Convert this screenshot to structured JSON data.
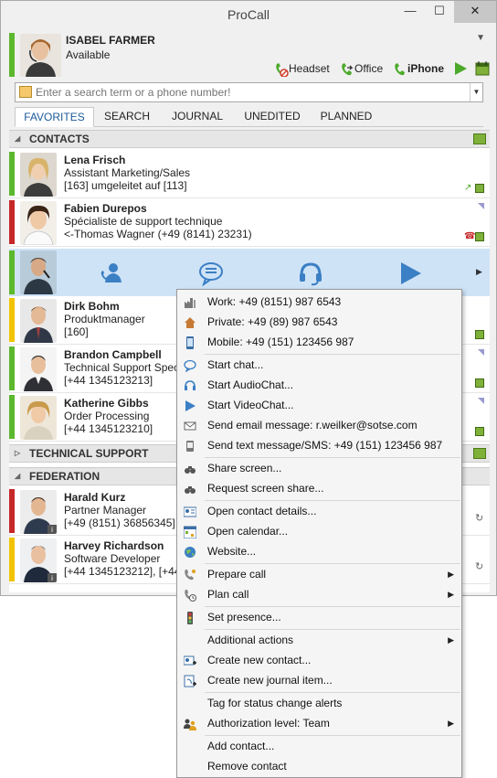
{
  "window": {
    "title": "ProCall",
    "min": "—",
    "max": "☐",
    "close": "✕"
  },
  "me": {
    "name": "ISABEL FARMER",
    "status": "Available",
    "status_color": "#5cb82e"
  },
  "devices": {
    "headset": "Headset",
    "office": "Office",
    "iphone": "iPhone"
  },
  "search": {
    "placeholder": "Enter a search term or a phone number!"
  },
  "tabs": [
    "FAVORITES",
    "SEARCH",
    "JOURNAL",
    "UNEDITED",
    "PLANNED"
  ],
  "groups": {
    "contacts": "CONTACTS",
    "technical_support": "TECHNICAL SUPPORT",
    "federation": "FEDERATION"
  },
  "contacts": [
    {
      "name": "Lena Frisch",
      "line2": "Assistant Marketing/Sales",
      "line3": "[163] umgeleitet auf [113]",
      "presence": "#5cb82e"
    },
    {
      "name": "Fabien Durepos",
      "line2": "Spécialiste de support technique",
      "line3": "<-Thomas Wagner (+49 (8141) 23231)",
      "presence": "#c62828"
    },
    {
      "name": "",
      "line2": "",
      "line3": "",
      "presence": "#5cb82e"
    },
    {
      "name": "Dirk Bohm",
      "line2": "Produktmanager",
      "line3": "[160]",
      "presence": "#f2c300"
    },
    {
      "name": "Brandon Campbell",
      "line2": "Technical Support Spec",
      "line3": "[+44 1345123213]",
      "presence": "#5cb82e"
    },
    {
      "name": "Katherine Gibbs",
      "line2": "Order Processing",
      "line3": "[+44 1345123210]",
      "presence": "#5cb82e"
    }
  ],
  "federation": [
    {
      "name": "Harald Kurz",
      "line2": "Partner Manager",
      "line3": "[+49 (8151) 36856345]",
      "presence": "#c62828"
    },
    {
      "name": "Harvey Richardson",
      "line2": "Software Developer",
      "line3": "[+44 1345123212], [+44",
      "presence": "#f2c300"
    }
  ],
  "menu": [
    {
      "label": "Work: +49 (8151) 987 6543",
      "icon": "factory-icon"
    },
    {
      "label": "Private: +49 (89) 987 6543",
      "icon": "house-icon"
    },
    {
      "label": "Mobile: +49 (151) 123456 987",
      "icon": "mobile-icon"
    },
    {
      "label": "Start chat...",
      "icon": "chat-icon"
    },
    {
      "label": "Start AudioChat...",
      "icon": "headset-icon"
    },
    {
      "label": "Start VideoChat...",
      "icon": "play-icon"
    },
    {
      "label": "Send email message: r.weilker@sotse.com",
      "icon": "envelope-icon"
    },
    {
      "label": "Send text message/SMS: +49 (151) 123456 987",
      "icon": "sms-icon"
    },
    {
      "label": "Share screen...",
      "icon": "binoculars-icon"
    },
    {
      "label": "Request screen share...",
      "icon": "binoculars-icon"
    },
    {
      "label": "Open contact details...",
      "icon": "contact-card-icon"
    },
    {
      "label": "Open calendar...",
      "icon": "calendar-icon"
    },
    {
      "label": "Website...",
      "icon": "globe-icon"
    },
    {
      "label": "Prepare call",
      "icon": "phone-prepare-icon"
    },
    {
      "label": "Plan call",
      "icon": "phone-plan-icon"
    },
    {
      "label": "Set presence...",
      "icon": "traffic-light-icon"
    },
    {
      "label": "Additional actions",
      "icon": ""
    },
    {
      "label": "Create new contact...",
      "icon": "new-contact-icon"
    },
    {
      "label": "Create new journal item...",
      "icon": "new-journal-icon"
    },
    {
      "label": "Tag for status change alerts",
      "icon": ""
    },
    {
      "label": "Authorization level: Team",
      "icon": "people-icon"
    },
    {
      "label": "Add contact...",
      "icon": ""
    },
    {
      "label": "Remove contact",
      "icon": ""
    }
  ],
  "colors": {
    "accent": "#1c5a9a",
    "selection": "#cfe3f7",
    "action_icons": "#3b7fc4"
  }
}
